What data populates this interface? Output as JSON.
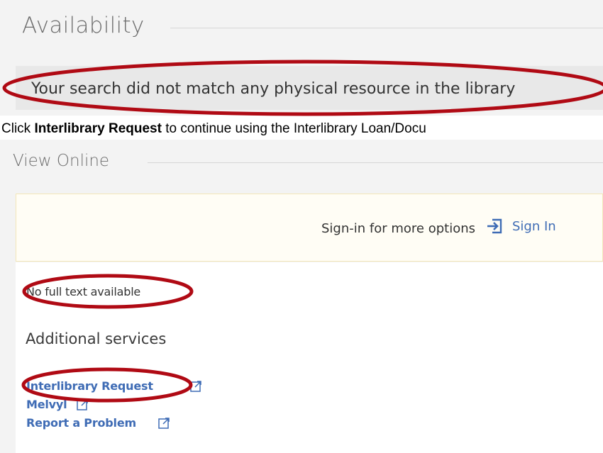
{
  "availability": {
    "heading": "Availability",
    "notice": "Your search did not match any physical resource in the library"
  },
  "instruction": {
    "prefix": "Click ",
    "bold": "Interlibrary Request",
    "suffix": " to continue using the Interlibrary Loan/Docu"
  },
  "view_online": {
    "heading": "View Online",
    "signin_prompt": "Sign-in for more options",
    "signin_label": "Sign In",
    "fulltext_status": "No full text available",
    "additional_heading": "Additional services",
    "services": [
      {
        "label": "Interlibrary Request",
        "icon": "external-link-icon"
      },
      {
        "label": "Melvyl",
        "icon": "external-link-icon"
      },
      {
        "label": "Report a Problem",
        "icon": "external-link-icon"
      }
    ]
  },
  "colors": {
    "link": "#3f6cb5",
    "annotation": "#b00a14",
    "panel_bg": "#f3f3f3",
    "signin_bg": "#fffdf5"
  }
}
